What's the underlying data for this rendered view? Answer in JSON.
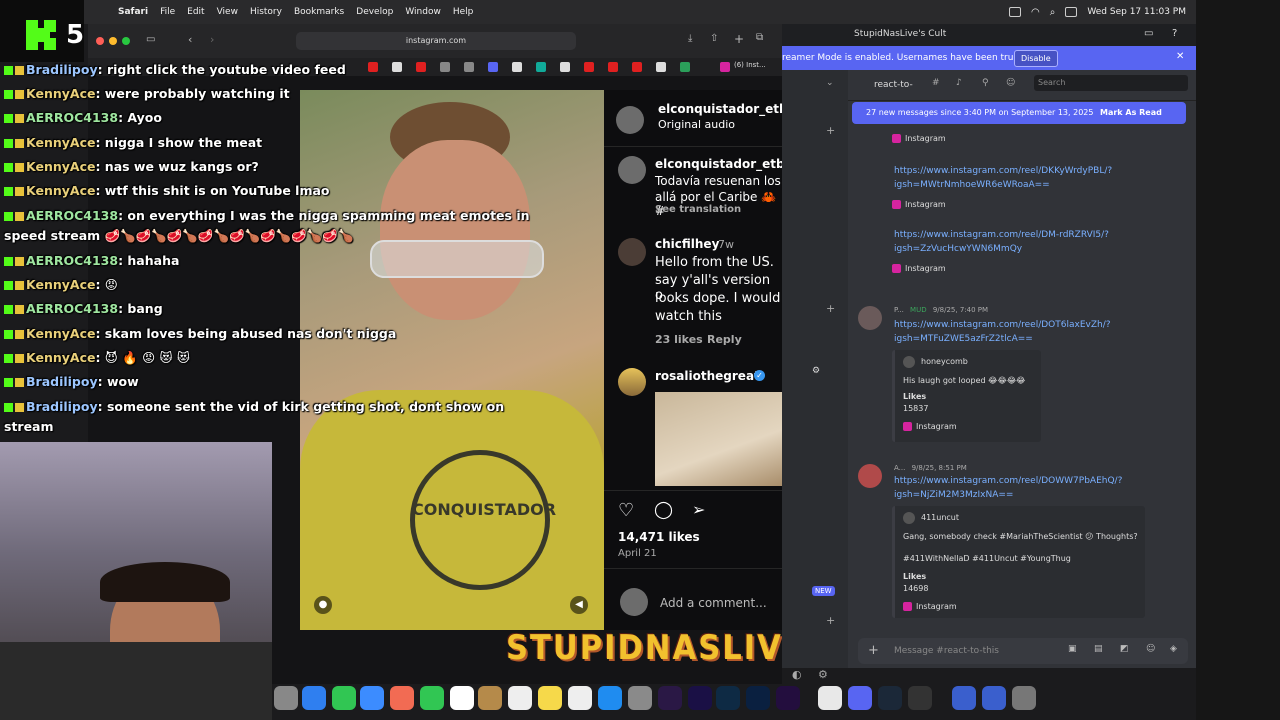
{
  "menubar": {
    "app": "Safari",
    "items": [
      "File",
      "Edit",
      "View",
      "History",
      "Bookmarks",
      "Develop",
      "Window",
      "Help"
    ],
    "datetime": "Wed Sep 17  11:03 PM"
  },
  "kick": {
    "count": "5"
  },
  "safari": {
    "url": "instagram.com",
    "tab_label": "(6) Inst..."
  },
  "chat": [
    {
      "user": "Bradilipoy",
      "color": "b",
      "msg": ": right click the youtube video feed"
    },
    {
      "user": "KennyAce",
      "color": "y",
      "msg": ": were probably watching it"
    },
    {
      "user": "AERROC4138",
      "color": "g",
      "msg": ": Ayoo"
    },
    {
      "user": "KennyAce",
      "color": "y",
      "msg": ": nigga I show the meat"
    },
    {
      "user": "KennyAce",
      "color": "y",
      "msg": ": nas we wuz kangs or?"
    },
    {
      "user": "KennyAce",
      "color": "y",
      "msg": ": wtf this shit is on YouTube lmao"
    },
    {
      "user": "AERROC4138",
      "color": "g",
      "msg": ": on everything I was the nigga spamming meat emotes in"
    },
    {
      "user": "",
      "color": "",
      "msg": "speed stream 🥩🍗🥩🍗🥩🍗🥩🍗🥩🍗🥩🍗🥩🍗🥩🍗"
    },
    {
      "user": "AERROC4138",
      "color": "g",
      "msg": ": hahaha"
    },
    {
      "user": "KennyAce",
      "color": "y",
      "msg": ": 😡"
    },
    {
      "user": "AERROC4138",
      "color": "g",
      "msg": ": bang"
    },
    {
      "user": "KennyAce",
      "color": "y",
      "msg": ": skam loves being abused nas don't nigga"
    },
    {
      "user": "KennyAce",
      "color": "y",
      "msg": ": 😈 🔥 😡 😻 😻"
    },
    {
      "user": "Bradilipoy",
      "color": "b",
      "msg": ": wow"
    },
    {
      "user": "Bradilipoy",
      "color": "b",
      "msg": ": someone sent the vid of kirk getting shot, dont show on"
    },
    {
      "user": "",
      "color": "",
      "msg": "stream"
    }
  ],
  "video": {
    "shirt_text": "CONQUISTADOR"
  },
  "instagram": {
    "header_user": "elconquistador_etb",
    "header_sub": "Original audio",
    "c1_user": "elconquistador_etb",
    "c1_text1": "Todavía resuenan los",
    "c1_text2": "allá por el Caribe 🦀 #",
    "c1_translate": "See translation",
    "c2_user": "chicfilhey",
    "c2_time": "7w",
    "c2_lines": [
      "Hello from the US. .",
      "say y'all's version o",
      "looks dope. I would",
      "watch this"
    ],
    "c2_likes": "23 likes",
    "c2_reply": "Reply",
    "c3_user": "rosaliothegreat",
    "likes": "14,471 likes",
    "date": "April 21",
    "add_comment": "Add a comment..."
  },
  "streamname": "STUPIDNASLIVE",
  "discord": {
    "title": "StupidNasLive's Cult",
    "streamer_banner": "reamer Mode is enabled. Usernames have been truncated.",
    "disable": "Disable",
    "channel": "react-to-",
    "search": "Search",
    "new_msgs": "27 new messages since 3:40 PM on September 13, 2025",
    "mark_read": "Mark As Read",
    "instagram_label": "Instagram",
    "link1": [
      "https://www.instagram.com/reel/DKKyWrdyPBL/?",
      "igsh=MWtrNmhoeWR6eWRoaA=="
    ],
    "link2": [
      "https://www.instagram.com/reel/DM-rdRZRVI5/?",
      "igsh=ZzVucHcwYWN6MmQy"
    ],
    "msg3": {
      "user": "P...",
      "tag": "MUD",
      "time": "9/8/25, 7:40 PM",
      "link": [
        "https://www.instagram.com/reel/DOT6laxEvZh/?",
        "igsh=MTFuZWE5azFrZ2tlcA=="
      ],
      "embed_user": "honeycomb",
      "embed_text": "His laugh got looped 😂😂😂😂",
      "likes_label": "Likes",
      "likes": "15837"
    },
    "msg4": {
      "user": "A...",
      "time": "9/8/25, 8:51 PM",
      "link": [
        "https://www.instagram.com/reel/DOWW7PbAEhQ/?",
        "igsh=NjZiM2M3MzIxNA=="
      ],
      "embed_user": "411uncut",
      "embed_text": "Gang, somebody check #MariahTheScientist 😕 Thoughts?",
      "embed_tags": "#411WithNellaD #411Uncut #YoungThug",
      "likes_label": "Likes",
      "likes": "14698"
    },
    "new_badge": "NEW",
    "message_placeholder": "Message #react-to-this"
  }
}
